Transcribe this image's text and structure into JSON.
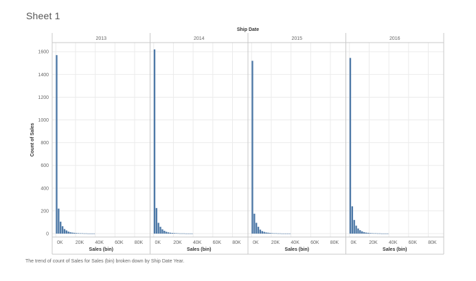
{
  "sheet": {
    "title": "Sheet 1",
    "caption": "The trend of count of Sales for Sales (bin) broken down by Ship Date Year."
  },
  "colors": {
    "bar": "#4e79a7",
    "grid": "#ebebeb",
    "axis": "#c8c8c8",
    "text": "#666666"
  },
  "chart_data": {
    "type": "bar",
    "column_header": "Ship Date",
    "xlabel": "Sales (bin)",
    "ylabel": "Count of Sales",
    "x_tick_labels": [
      "0K",
      "20K",
      "40K",
      "60K",
      "80K"
    ],
    "x_tick_values": [
      0,
      20000,
      40000,
      60000,
      80000
    ],
    "xlim": [
      -3000,
      95000
    ],
    "bin_width": 2000,
    "y_tick_labels": [
      "0",
      "200",
      "400",
      "600",
      "800",
      "1000",
      "1200",
      "1400",
      "1600"
    ],
    "y_tick_values": [
      0,
      200,
      400,
      600,
      800,
      1000,
      1200,
      1400,
      1600
    ],
    "ylim": [
      -30,
      1680
    ],
    "panels": [
      {
        "name": "2013",
        "bin_starts": [
          0,
          2000,
          4000,
          6000,
          8000,
          10000,
          12000,
          14000,
          16000,
          18000,
          20000,
          22000,
          24000,
          26000,
          28000,
          30000,
          32000,
          34000,
          36000,
          38000
        ],
        "counts": [
          1570,
          220,
          105,
          65,
          40,
          28,
          18,
          12,
          9,
          7,
          5,
          4,
          3,
          3,
          2,
          2,
          1,
          1,
          1,
          1
        ]
      },
      {
        "name": "2014",
        "bin_starts": [
          0,
          2000,
          4000,
          6000,
          8000,
          10000,
          12000,
          14000,
          16000,
          18000,
          20000,
          22000,
          24000,
          26000,
          28000,
          30000,
          32000,
          34000,
          36000,
          38000
        ],
        "counts": [
          1620,
          225,
          95,
          60,
          38,
          25,
          16,
          11,
          8,
          6,
          5,
          4,
          3,
          2,
          2,
          2,
          1,
          1,
          1,
          1
        ]
      },
      {
        "name": "2015",
        "bin_starts": [
          0,
          2000,
          4000,
          6000,
          8000,
          10000,
          12000,
          14000,
          16000,
          18000,
          20000,
          22000,
          24000,
          26000,
          28000,
          30000,
          32000,
          34000,
          36000,
          38000
        ],
        "counts": [
          1520,
          175,
          95,
          60,
          35,
          22,
          15,
          10,
          8,
          6,
          4,
          3,
          3,
          2,
          2,
          1,
          1,
          1,
          1,
          1
        ]
      },
      {
        "name": "2016",
        "bin_starts": [
          0,
          2000,
          4000,
          6000,
          8000,
          10000,
          12000,
          14000,
          16000,
          18000,
          20000,
          22000,
          24000,
          26000,
          28000,
          30000,
          32000,
          34000,
          36000,
          38000
        ],
        "counts": [
          1545,
          240,
          120,
          70,
          45,
          30,
          20,
          13,
          9,
          7,
          5,
          4,
          3,
          3,
          2,
          2,
          1,
          1,
          1,
          1
        ]
      }
    ]
  }
}
